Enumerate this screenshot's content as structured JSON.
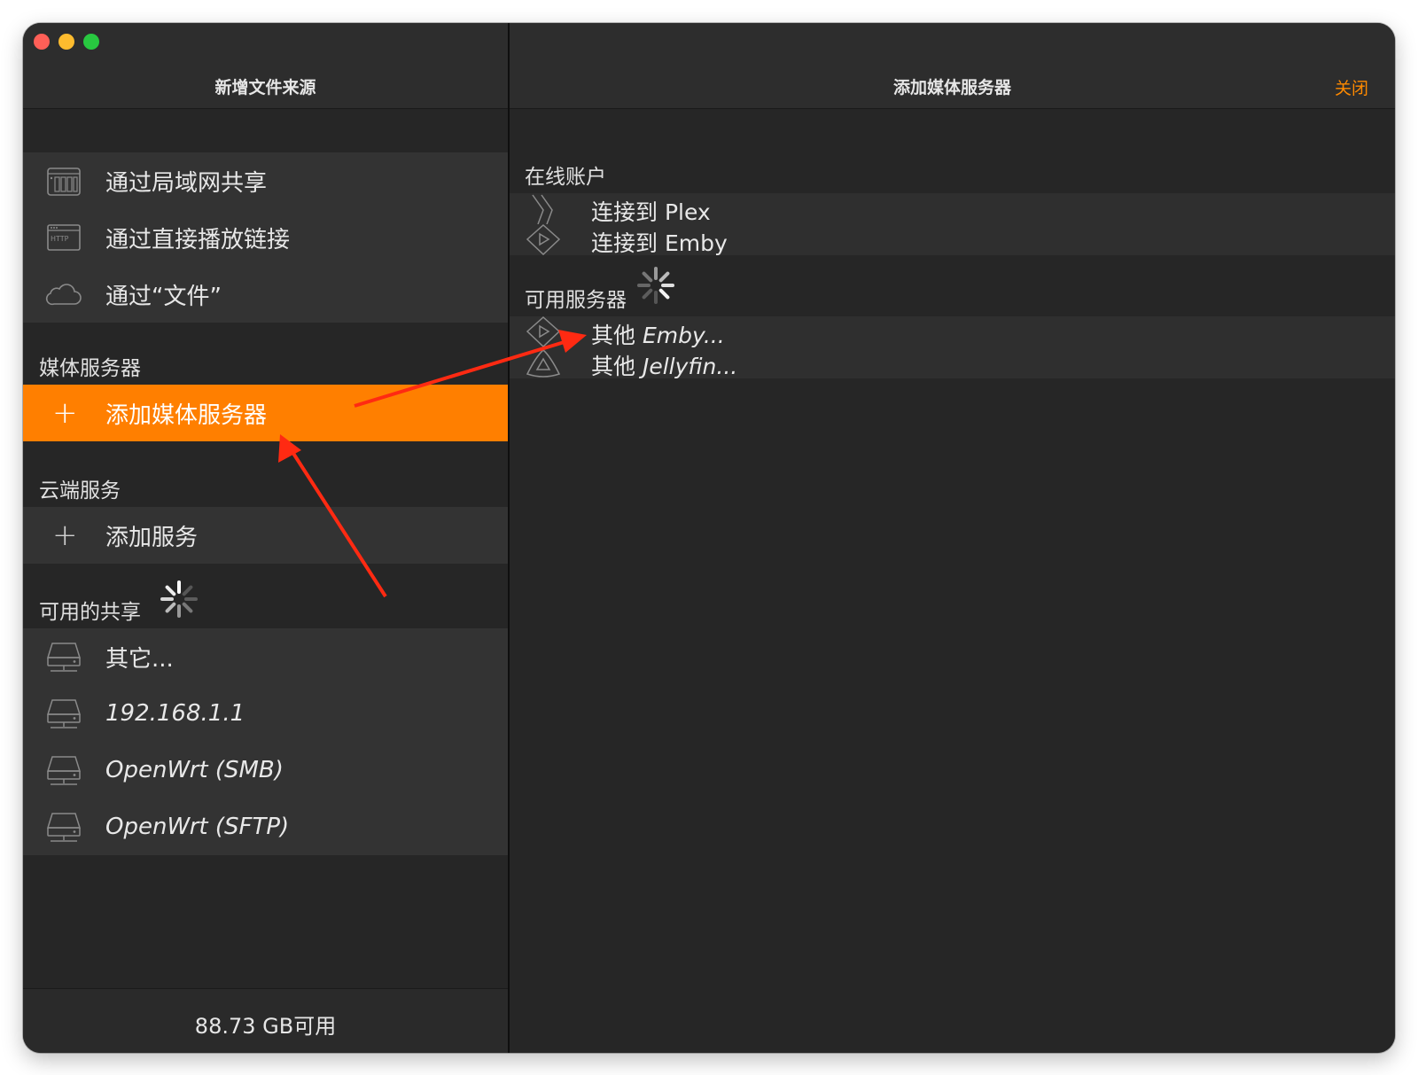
{
  "sidebar": {
    "title": "新增文件来源",
    "sources": [
      {
        "label": "通过局域网共享",
        "icon": "nas-icon"
      },
      {
        "label": "通过直接播放链接",
        "icon": "http-icon"
      },
      {
        "label": "通过“文件”",
        "icon": "cloud-icon"
      }
    ],
    "media_section_title": "媒体服务器",
    "add_media_server_label": "添加媒体服务器",
    "cloud_section_title": "云端服务",
    "add_service_label": "添加服务",
    "shares_section_title": "可用的共享",
    "shares": [
      {
        "label": "其它...",
        "italic": false
      },
      {
        "label": "192.168.1.1",
        "italic": true
      },
      {
        "label": "OpenWrt (SMB)",
        "italic": true
      },
      {
        "label": "OpenWrt (SFTP)",
        "italic": true
      }
    ],
    "footer": "88.73 GB可用"
  },
  "main": {
    "title": "添加媒体服务器",
    "close_label": "关闭",
    "online_section_title": "在线账户",
    "online_accounts": [
      {
        "label": "连接到 Plex",
        "icon": "plex-icon"
      },
      {
        "label": "连接到 Emby",
        "icon": "emby-icon"
      }
    ],
    "servers_section_title": "可用服务器",
    "servers": [
      {
        "prefix": "其他 ",
        "name": "Emby...",
        "icon": "emby-icon"
      },
      {
        "prefix": "其他 ",
        "name": "Jellyfin...",
        "icon": "jellyfin-icon"
      }
    ]
  },
  "colors": {
    "accent": "#ff7f00",
    "close": "#ff8a00",
    "annotation_arrow": "#ff2a12"
  }
}
